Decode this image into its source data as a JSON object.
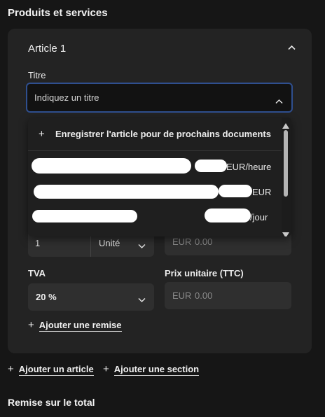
{
  "section": {
    "title": "Produits et services",
    "discount_total_title": "Remise sur le total"
  },
  "article": {
    "title": "Article 1",
    "title_field": {
      "label": "Titre",
      "placeholder": "Indiquez un titre"
    },
    "dropdown": {
      "register_label": "Enregistrer l'article pour de prochains documents",
      "options": [
        {
          "name": "",
          "price": "EUR/heure"
        },
        {
          "name": "",
          "price": "EUR"
        },
        {
          "name": "",
          "price": "/jour"
        }
      ]
    },
    "quantity": {
      "value": "1",
      "unit": "Unité"
    },
    "price_ht": {
      "currency": "EUR",
      "value": "0.00"
    },
    "vat": {
      "label": "TVA",
      "value": "20 %"
    },
    "price_ttc": {
      "label": "Prix unitaire (TTC)",
      "currency": "EUR",
      "value": "0.00"
    },
    "add_discount": "Ajouter une remise"
  },
  "actions": {
    "add_article": "Ajouter un article",
    "add_section": "Ajouter une section"
  }
}
